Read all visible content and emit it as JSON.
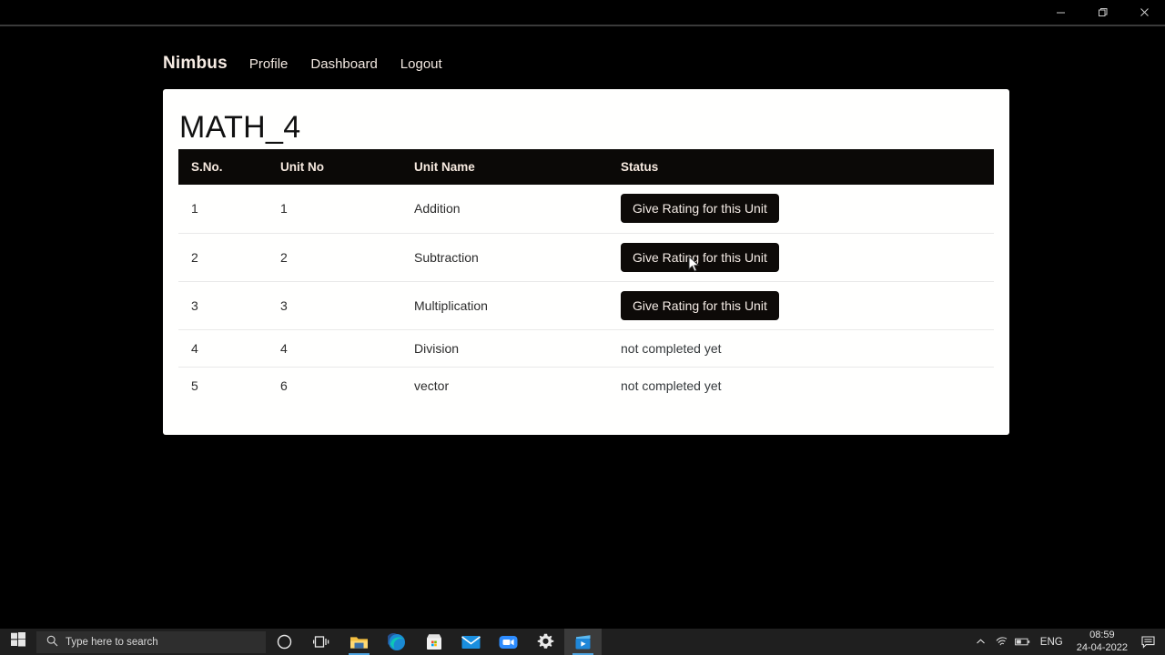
{
  "window": {
    "minimize_label": "Minimize",
    "restore_label": "Restore",
    "close_label": "Close"
  },
  "navbar": {
    "brand": "Nimbus",
    "links": [
      {
        "label": "Profile"
      },
      {
        "label": "Dashboard"
      },
      {
        "label": "Logout"
      }
    ]
  },
  "card": {
    "title": "MATH_4",
    "table": {
      "columns": [
        "S.No.",
        "Unit No",
        "Unit Name",
        "Status"
      ],
      "rows": [
        {
          "sno": "1",
          "unit_no": "1",
          "unit_name": "Addition",
          "status_type": "button",
          "status": "Give Rating for this Unit"
        },
        {
          "sno": "2",
          "unit_no": "2",
          "unit_name": "Subtraction",
          "status_type": "button",
          "status": "Give Rating for this Unit"
        },
        {
          "sno": "3",
          "unit_no": "3",
          "unit_name": "Multiplication",
          "status_type": "button",
          "status": "Give Rating for this Unit"
        },
        {
          "sno": "4",
          "unit_no": "4",
          "unit_name": "Division",
          "status_type": "text",
          "status": "not completed yet"
        },
        {
          "sno": "5",
          "unit_no": "6",
          "unit_name": "vector",
          "status_type": "text",
          "status": "not completed yet"
        }
      ]
    }
  },
  "taskbar": {
    "search_placeholder": "Type here to search",
    "icons": [
      {
        "name": "cortana-icon"
      },
      {
        "name": "task-view-icon"
      },
      {
        "name": "file-explorer-icon"
      },
      {
        "name": "edge-browser-icon"
      },
      {
        "name": "microsoft-store-icon"
      },
      {
        "name": "mail-icon"
      },
      {
        "name": "zoom-meetings-icon"
      },
      {
        "name": "settings-gear-icon"
      },
      {
        "name": "media-player-icon"
      }
    ],
    "tray": {
      "language": "ENG",
      "time": "08:59",
      "date": "24-04-2022"
    }
  },
  "colors": {
    "page_background": "#000000",
    "card_background": "#fffffe",
    "header_row": "#0b0907",
    "header_text": "#f6e9df",
    "button_background": "#0d0a08",
    "taskbar": "#1f1f1f"
  }
}
